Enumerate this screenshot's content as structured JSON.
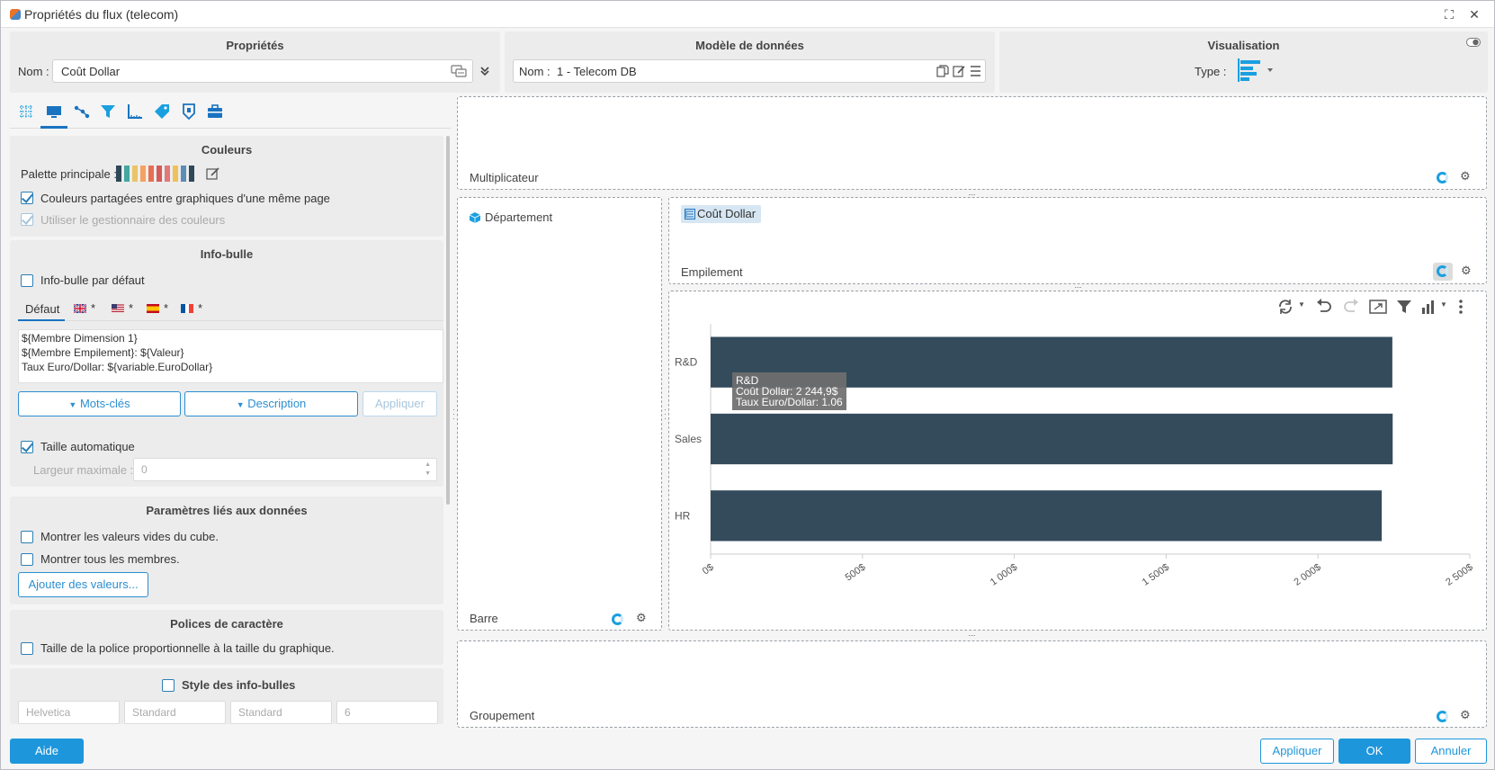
{
  "window": {
    "title": "Propriétés du flux (telecom)"
  },
  "properties": {
    "title": "Propriétés",
    "name_label": "Nom :",
    "name_value": "Coût Dollar"
  },
  "data_model": {
    "title": "Modèle de données",
    "name_label": "Nom :",
    "name_value": "1 - Telecom DB"
  },
  "visualisation": {
    "title": "Visualisation",
    "type_label": "Type :"
  },
  "tabs": [
    "grid-icon",
    "display-icon",
    "hierarchy-icon",
    "filter-icon",
    "ruler-icon",
    "tag-icon",
    "shield-icon",
    "toolbox-icon"
  ],
  "colors_section": {
    "title": "Couleurs",
    "palette_label": "Palette principale :",
    "palette": [
      "#2f4858",
      "#46a6a0",
      "#e9c46a",
      "#f4a261",
      "#e76f51",
      "#d65a5a",
      "#e07a7a",
      "#f0c05a",
      "#5b8db8",
      "#2f4858"
    ],
    "shared_label": "Couleurs partagées entre graphiques d'une même page",
    "shared_checked": true,
    "manager_label": "Utiliser le gestionnaire des couleurs",
    "manager_checked": true
  },
  "tooltip_section": {
    "title": "Info-bulle",
    "default_label": "Info-bulle par défaut",
    "lang_tabs": [
      "Défaut",
      "*",
      "*",
      "*",
      "*"
    ],
    "template_lines": [
      "${Membre Dimension 1}",
      "${Membre Empilement}: ${Valeur}",
      "Taux Euro/Dollar: ${variable.EuroDollar}"
    ],
    "keywords_button": "Mots-clés",
    "description_button": "Description",
    "apply_button": "Appliquer",
    "auto_size_label": "Taille automatique",
    "max_width_label": "Largeur maximale :",
    "max_width_value": "0"
  },
  "data_params": {
    "title": "Paramètres liés aux données",
    "empty_values_label": "Montrer les valeurs vides du cube.",
    "all_members_label": "Montrer tous les membres.",
    "add_values_button": "Ajouter des valeurs..."
  },
  "fonts_section": {
    "title": "Polices de caractère",
    "proportional_label": "Taille de la police proportionnelle à la taille du graphique."
  },
  "tooltip_style": {
    "title": "Style des info-bulles",
    "inputs": [
      "Helvetica",
      "Standard",
      "Standard",
      "6"
    ]
  },
  "zones": {
    "multiplier": "Multiplicateur",
    "department": "Département",
    "bar": "Barre",
    "measure_chip": "Coût Dollar",
    "stacking": "Empilement",
    "grouping": "Groupement"
  },
  "chart_tooltip": {
    "line1": "R&D",
    "line2": "Coût Dollar: 2 244,9$",
    "line3": "Taux Euro/Dollar: 1.06"
  },
  "chart_data": {
    "type": "bar",
    "orientation": "horizontal",
    "categories": [
      "R&D",
      "Sales",
      "HR"
    ],
    "values": [
      2244.9,
      2246,
      2210
    ],
    "xlim": [
      0,
      2500
    ],
    "xticks": [
      0,
      500,
      1000,
      1500,
      2000,
      2500
    ],
    "xtick_labels": [
      "0$",
      "500$",
      "1 000$",
      "1 500$",
      "2 000$",
      "2 500$"
    ],
    "bar_color": "#344b5c",
    "grid": false
  },
  "footer": {
    "help": "Aide",
    "apply": "Appliquer",
    "ok": "OK",
    "cancel": "Annuler"
  }
}
